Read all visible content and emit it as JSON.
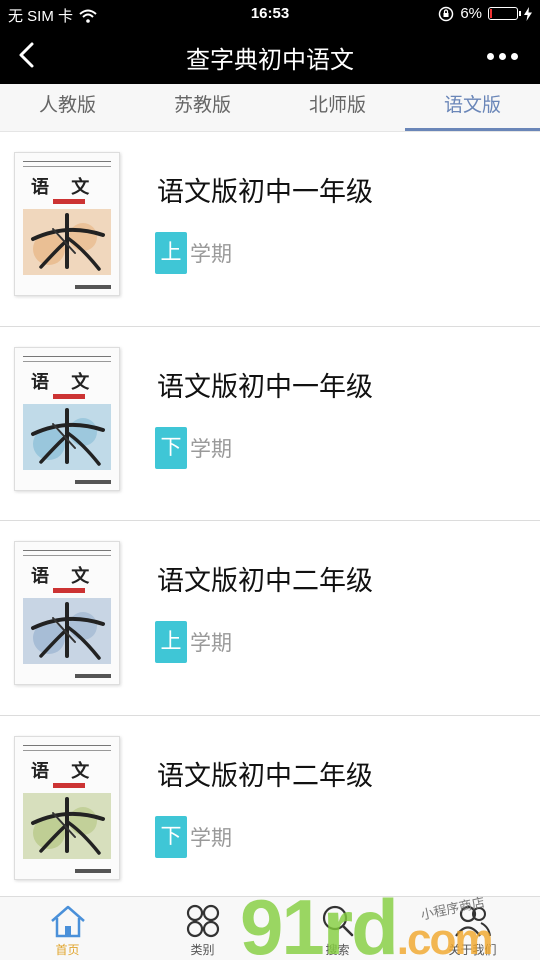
{
  "status_bar": {
    "carrier": "无 SIM 卡",
    "time": "16:53",
    "battery_percent": "6%",
    "battery_level": 0.06
  },
  "nav": {
    "title": "查字典初中语文",
    "back_icon": "chevron-left-icon",
    "more_icon": "more-dots-icon"
  },
  "tabs": [
    {
      "label": "人教版",
      "active": false
    },
    {
      "label": "苏教版",
      "active": false
    },
    {
      "label": "北师版",
      "active": false
    },
    {
      "label": "语文版",
      "active": true
    }
  ],
  "books": [
    {
      "title": "语文版初中一年级",
      "term": "上",
      "term_suffix": "学期",
      "cover_text": "语 文",
      "cover_color": "#e8b98a"
    },
    {
      "title": "语文版初中一年级",
      "term": "下",
      "term_suffix": "学期",
      "cover_text": "语 文",
      "cover_color": "#8fc0d8"
    },
    {
      "title": "语文版初中二年级",
      "term": "上",
      "term_suffix": "学期",
      "cover_text": "语 文",
      "cover_color": "#9fb6d2"
    },
    {
      "title": "语文版初中二年级",
      "term": "下",
      "term_suffix": "学期",
      "cover_text": "语 文",
      "cover_color": "#b9c98a"
    }
  ],
  "bottom_tabs": [
    {
      "label": "首页",
      "icon": "home-icon",
      "active": true
    },
    {
      "label": "类别",
      "icon": "category-icon",
      "active": false
    },
    {
      "label": "搜索",
      "icon": "search-icon",
      "active": false
    },
    {
      "label": "关于我们",
      "icon": "about-icon",
      "active": false
    }
  ],
  "watermark": {
    "brand": "91rd",
    "domain": ".com",
    "tagline": "小程序商店"
  },
  "colors": {
    "accent_tab": "#6a86b8",
    "term_badge": "#3fc6d6",
    "active_bottom": "#e1a52d"
  }
}
